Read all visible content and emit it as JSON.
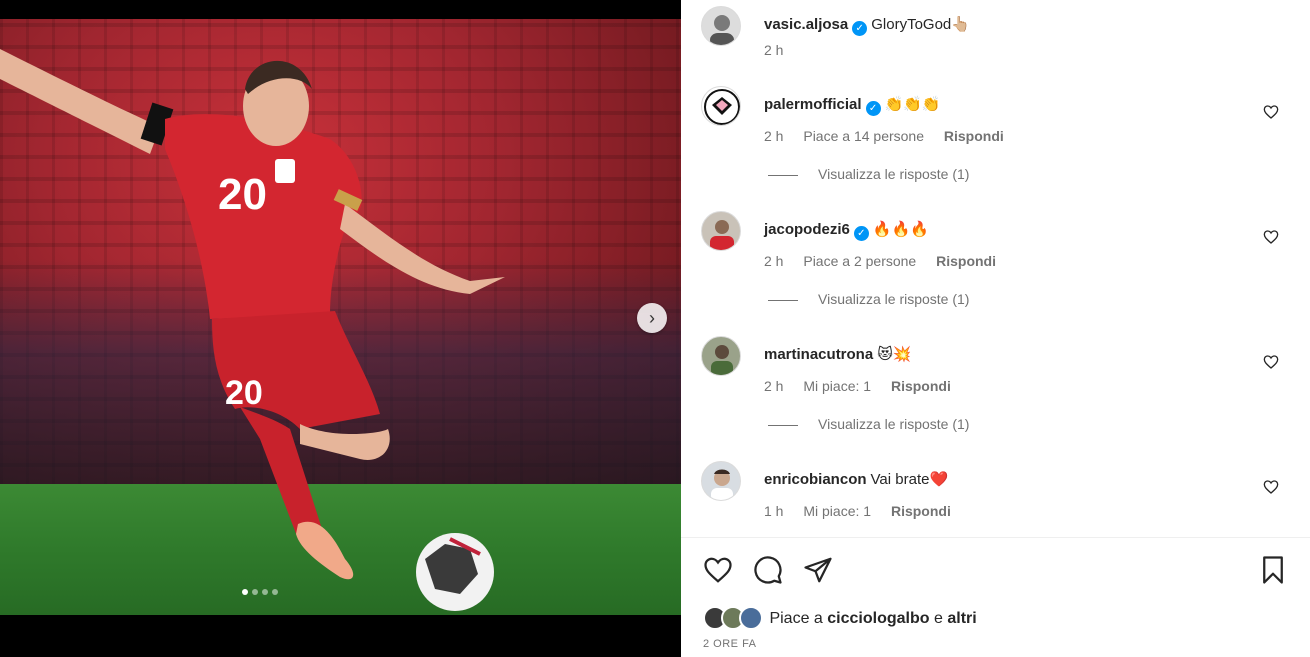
{
  "post": {
    "author": "vasic.aljosa",
    "caption": "GloryToGod👆🏼",
    "caption_time": "2 h"
  },
  "comments": [
    {
      "username": "palermofficial",
      "text": "👏👏👏",
      "time": "2 h",
      "likes": "Piace a 14 persone",
      "reply": "Rispondi",
      "view_replies": "Visualizza le risposte (1)",
      "verified": true
    },
    {
      "username": "jacopodezi6",
      "text": "🔥🔥🔥",
      "time": "2 h",
      "likes": "Piace a 2 persone",
      "reply": "Rispondi",
      "view_replies": "Visualizza le risposte (1)",
      "verified": true
    },
    {
      "username": "martinacutrona",
      "text": "😻💥",
      "time": "2 h",
      "likes": "Mi piace: 1",
      "reply": "Rispondi",
      "view_replies": "Visualizza le risposte (1)",
      "verified": false
    },
    {
      "username": "enricobiancon",
      "text": "Vai brate❤️",
      "time": "1 h",
      "likes": "Mi piace: 1",
      "reply": "Rispondi",
      "verified": false
    }
  ],
  "likes_line": {
    "prefix": "Piace a",
    "user": "cicciologalbo",
    "conj": "e",
    "others": "altri"
  },
  "post_time": "2 ORE FA",
  "media": {
    "jersey_number": "20",
    "carousel_dots": 4,
    "active_dot": 0
  },
  "icons": {
    "like": "heart-icon",
    "comment": "comment-icon",
    "share": "send-icon",
    "save": "bookmark-icon",
    "next": "chevron-right-icon"
  },
  "colors": {
    "verified": "#0095f6",
    "jersey": "#d32630",
    "pitch": "#2f7a2b"
  }
}
